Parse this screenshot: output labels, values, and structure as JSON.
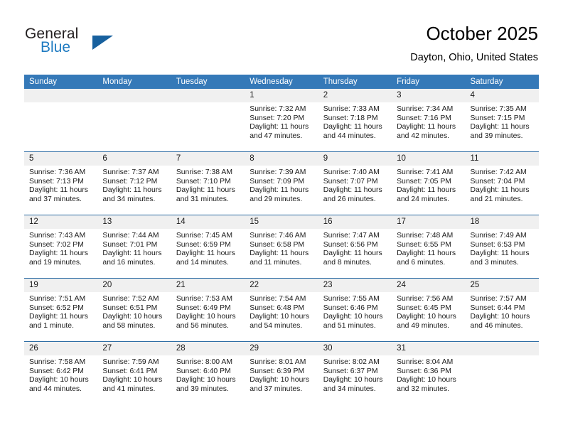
{
  "logo": {
    "word_one": "General",
    "word_two": "Blue",
    "flag_icon": "triangle-flag-icon",
    "brand_blue": "#1f7bc1",
    "flag_blue": "#17609e"
  },
  "header": {
    "title": "October 2025",
    "subtitle": "Dayton, Ohio, United States"
  },
  "colors": {
    "header_row_bg": "#3579b8",
    "row_separator": "#2e6da4",
    "day_band_bg": "#f0f0f0"
  },
  "weekdays": [
    "Sunday",
    "Monday",
    "Tuesday",
    "Wednesday",
    "Thursday",
    "Friday",
    "Saturday"
  ],
  "weeks": [
    [
      {
        "day": "",
        "empty": true
      },
      {
        "day": "",
        "empty": true
      },
      {
        "day": "",
        "empty": true
      },
      {
        "day": "1",
        "sunrise": "Sunrise: 7:32 AM",
        "sunset": "Sunset: 7:20 PM",
        "daylight_1": "Daylight: 11 hours",
        "daylight_2": "and 47 minutes."
      },
      {
        "day": "2",
        "sunrise": "Sunrise: 7:33 AM",
        "sunset": "Sunset: 7:18 PM",
        "daylight_1": "Daylight: 11 hours",
        "daylight_2": "and 44 minutes."
      },
      {
        "day": "3",
        "sunrise": "Sunrise: 7:34 AM",
        "sunset": "Sunset: 7:16 PM",
        "daylight_1": "Daylight: 11 hours",
        "daylight_2": "and 42 minutes."
      },
      {
        "day": "4",
        "sunrise": "Sunrise: 7:35 AM",
        "sunset": "Sunset: 7:15 PM",
        "daylight_1": "Daylight: 11 hours",
        "daylight_2": "and 39 minutes."
      }
    ],
    [
      {
        "day": "5",
        "sunrise": "Sunrise: 7:36 AM",
        "sunset": "Sunset: 7:13 PM",
        "daylight_1": "Daylight: 11 hours",
        "daylight_2": "and 37 minutes."
      },
      {
        "day": "6",
        "sunrise": "Sunrise: 7:37 AM",
        "sunset": "Sunset: 7:12 PM",
        "daylight_1": "Daylight: 11 hours",
        "daylight_2": "and 34 minutes."
      },
      {
        "day": "7",
        "sunrise": "Sunrise: 7:38 AM",
        "sunset": "Sunset: 7:10 PM",
        "daylight_1": "Daylight: 11 hours",
        "daylight_2": "and 31 minutes."
      },
      {
        "day": "8",
        "sunrise": "Sunrise: 7:39 AM",
        "sunset": "Sunset: 7:09 PM",
        "daylight_1": "Daylight: 11 hours",
        "daylight_2": "and 29 minutes."
      },
      {
        "day": "9",
        "sunrise": "Sunrise: 7:40 AM",
        "sunset": "Sunset: 7:07 PM",
        "daylight_1": "Daylight: 11 hours",
        "daylight_2": "and 26 minutes."
      },
      {
        "day": "10",
        "sunrise": "Sunrise: 7:41 AM",
        "sunset": "Sunset: 7:05 PM",
        "daylight_1": "Daylight: 11 hours",
        "daylight_2": "and 24 minutes."
      },
      {
        "day": "11",
        "sunrise": "Sunrise: 7:42 AM",
        "sunset": "Sunset: 7:04 PM",
        "daylight_1": "Daylight: 11 hours",
        "daylight_2": "and 21 minutes."
      }
    ],
    [
      {
        "day": "12",
        "sunrise": "Sunrise: 7:43 AM",
        "sunset": "Sunset: 7:02 PM",
        "daylight_1": "Daylight: 11 hours",
        "daylight_2": "and 19 minutes."
      },
      {
        "day": "13",
        "sunrise": "Sunrise: 7:44 AM",
        "sunset": "Sunset: 7:01 PM",
        "daylight_1": "Daylight: 11 hours",
        "daylight_2": "and 16 minutes."
      },
      {
        "day": "14",
        "sunrise": "Sunrise: 7:45 AM",
        "sunset": "Sunset: 6:59 PM",
        "daylight_1": "Daylight: 11 hours",
        "daylight_2": "and 14 minutes."
      },
      {
        "day": "15",
        "sunrise": "Sunrise: 7:46 AM",
        "sunset": "Sunset: 6:58 PM",
        "daylight_1": "Daylight: 11 hours",
        "daylight_2": "and 11 minutes."
      },
      {
        "day": "16",
        "sunrise": "Sunrise: 7:47 AM",
        "sunset": "Sunset: 6:56 PM",
        "daylight_1": "Daylight: 11 hours",
        "daylight_2": "and 8 minutes."
      },
      {
        "day": "17",
        "sunrise": "Sunrise: 7:48 AM",
        "sunset": "Sunset: 6:55 PM",
        "daylight_1": "Daylight: 11 hours",
        "daylight_2": "and 6 minutes."
      },
      {
        "day": "18",
        "sunrise": "Sunrise: 7:49 AM",
        "sunset": "Sunset: 6:53 PM",
        "daylight_1": "Daylight: 11 hours",
        "daylight_2": "and 3 minutes."
      }
    ],
    [
      {
        "day": "19",
        "sunrise": "Sunrise: 7:51 AM",
        "sunset": "Sunset: 6:52 PM",
        "daylight_1": "Daylight: 11 hours",
        "daylight_2": "and 1 minute."
      },
      {
        "day": "20",
        "sunrise": "Sunrise: 7:52 AM",
        "sunset": "Sunset: 6:51 PM",
        "daylight_1": "Daylight: 10 hours",
        "daylight_2": "and 58 minutes."
      },
      {
        "day": "21",
        "sunrise": "Sunrise: 7:53 AM",
        "sunset": "Sunset: 6:49 PM",
        "daylight_1": "Daylight: 10 hours",
        "daylight_2": "and 56 minutes."
      },
      {
        "day": "22",
        "sunrise": "Sunrise: 7:54 AM",
        "sunset": "Sunset: 6:48 PM",
        "daylight_1": "Daylight: 10 hours",
        "daylight_2": "and 54 minutes."
      },
      {
        "day": "23",
        "sunrise": "Sunrise: 7:55 AM",
        "sunset": "Sunset: 6:46 PM",
        "daylight_1": "Daylight: 10 hours",
        "daylight_2": "and 51 minutes."
      },
      {
        "day": "24",
        "sunrise": "Sunrise: 7:56 AM",
        "sunset": "Sunset: 6:45 PM",
        "daylight_1": "Daylight: 10 hours",
        "daylight_2": "and 49 minutes."
      },
      {
        "day": "25",
        "sunrise": "Sunrise: 7:57 AM",
        "sunset": "Sunset: 6:44 PM",
        "daylight_1": "Daylight: 10 hours",
        "daylight_2": "and 46 minutes."
      }
    ],
    [
      {
        "day": "26",
        "sunrise": "Sunrise: 7:58 AM",
        "sunset": "Sunset: 6:42 PM",
        "daylight_1": "Daylight: 10 hours",
        "daylight_2": "and 44 minutes."
      },
      {
        "day": "27",
        "sunrise": "Sunrise: 7:59 AM",
        "sunset": "Sunset: 6:41 PM",
        "daylight_1": "Daylight: 10 hours",
        "daylight_2": "and 41 minutes."
      },
      {
        "day": "28",
        "sunrise": "Sunrise: 8:00 AM",
        "sunset": "Sunset: 6:40 PM",
        "daylight_1": "Daylight: 10 hours",
        "daylight_2": "and 39 minutes."
      },
      {
        "day": "29",
        "sunrise": "Sunrise: 8:01 AM",
        "sunset": "Sunset: 6:39 PM",
        "daylight_1": "Daylight: 10 hours",
        "daylight_2": "and 37 minutes."
      },
      {
        "day": "30",
        "sunrise": "Sunrise: 8:02 AM",
        "sunset": "Sunset: 6:37 PM",
        "daylight_1": "Daylight: 10 hours",
        "daylight_2": "and 34 minutes."
      },
      {
        "day": "31",
        "sunrise": "Sunrise: 8:04 AM",
        "sunset": "Sunset: 6:36 PM",
        "daylight_1": "Daylight: 10 hours",
        "daylight_2": "and 32 minutes."
      },
      {
        "day": "",
        "empty": true
      }
    ]
  ]
}
